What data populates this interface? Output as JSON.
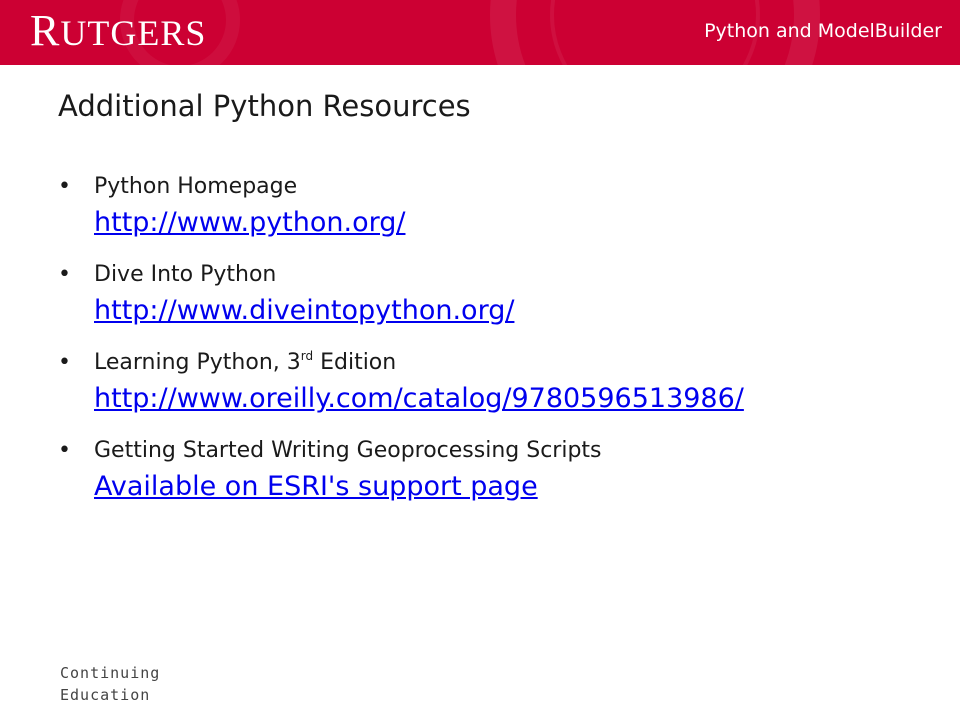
{
  "header": {
    "logo_initial": "R",
    "logo_rest": "UTGERS",
    "title": "Python and ModelBuilder"
  },
  "slide": {
    "title": "Additional Python Resources",
    "bullets": [
      {
        "label": "Python Homepage",
        "link": "http://www.python.org/"
      },
      {
        "label_pre": "Learning Python, 3",
        "label_sup": "rd",
        "label_post": " Edition",
        "link": "http://www.oreilly.com/catalog/9780596513986/"
      },
      {
        "label": "Dive Into Python",
        "link": "http://www.diveintopython.org/"
      },
      {
        "label": "Getting Started Writing Geoprocessing Scripts",
        "link": "Available on ESRI's support page"
      }
    ],
    "bullet_glyph": "•"
  },
  "footer": {
    "line1": "Continuing",
    "line2": "Education"
  },
  "colors": {
    "brand_red": "#cc0033",
    "link_blue": "#0000ee"
  }
}
